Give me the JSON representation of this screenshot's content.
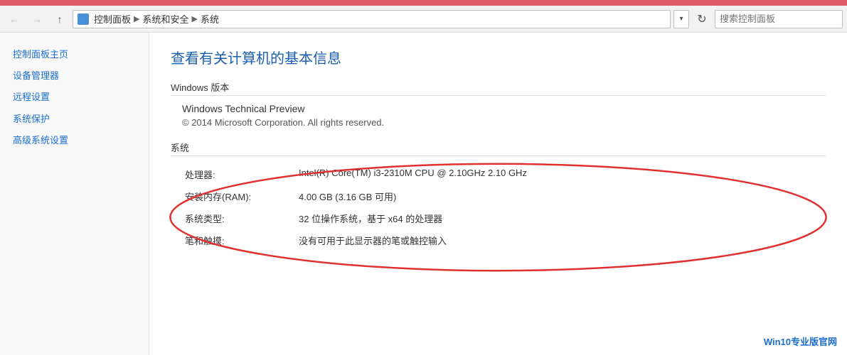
{
  "topbar": {
    "background_color": "#e05a6a"
  },
  "addressbar": {
    "back_button": "←",
    "forward_button": "→",
    "up_button": "↑",
    "breadcrumbs": [
      {
        "label": "控制面板",
        "id": "controlpanel"
      },
      {
        "label": "系统和安全",
        "id": "security"
      },
      {
        "label": "系统",
        "id": "system"
      }
    ],
    "dropdown_icon": "▾",
    "refresh_icon": "↻",
    "search_placeholder": "搜索控制面板"
  },
  "sidebar": {
    "items": [
      {
        "label": "控制面板主页",
        "id": "home"
      },
      {
        "label": "设备管理器",
        "id": "device-manager"
      },
      {
        "label": "远程设置",
        "id": "remote-settings"
      },
      {
        "label": "系统保护",
        "id": "system-protection"
      },
      {
        "label": "高级系统设置",
        "id": "advanced-settings"
      }
    ]
  },
  "content": {
    "page_title": "查看有关计算机的基本信息",
    "windows_version_label": "Windows 版本",
    "windows_version_name": "Windows Technical Preview",
    "windows_copyright": "© 2014 Microsoft Corporation. All rights reserved.",
    "system_section_label": "系统",
    "system_rows": [
      {
        "key": "处理器:",
        "value": "Intel(R) Core(TM) i3-2310M CPU @ 2.10GHz   2.10 GHz"
      },
      {
        "key": "安装内存(RAM):",
        "value": "4.00 GB (3.16 GB 可用)"
      },
      {
        "key": "系统类型:",
        "value": "32 位操作系统，基于 x64 的处理器"
      },
      {
        "key": "笔和触摸:",
        "value": "没有可用于此显示器的笔或触控输入"
      }
    ]
  },
  "watermark": {
    "text": "Win10专业版官网",
    "color": "#1a6dce"
  }
}
